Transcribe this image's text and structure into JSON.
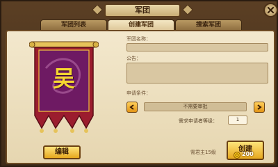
{
  "window": {
    "title": "军团"
  },
  "tabs": [
    {
      "label": "军团列表",
      "active": false
    },
    {
      "label": "创建军团",
      "active": true
    },
    {
      "label": "搜索军团",
      "active": false
    }
  ],
  "banner": {
    "emblem_char": "吴",
    "color": "#7a1a6a"
  },
  "buttons": {
    "edit": "编辑",
    "create": "创建"
  },
  "form": {
    "name_label": "军团名称：",
    "notice_label": "公告：",
    "condition_label": "申请条件：",
    "condition_value": "不需要审批",
    "level_label": "需求申请者等级：",
    "level_value": "1"
  },
  "requirement": {
    "text": "需君主15级",
    "cost": "200"
  },
  "colors": {
    "accent": "#e6a81f",
    "panel": "#f3e8cd"
  }
}
